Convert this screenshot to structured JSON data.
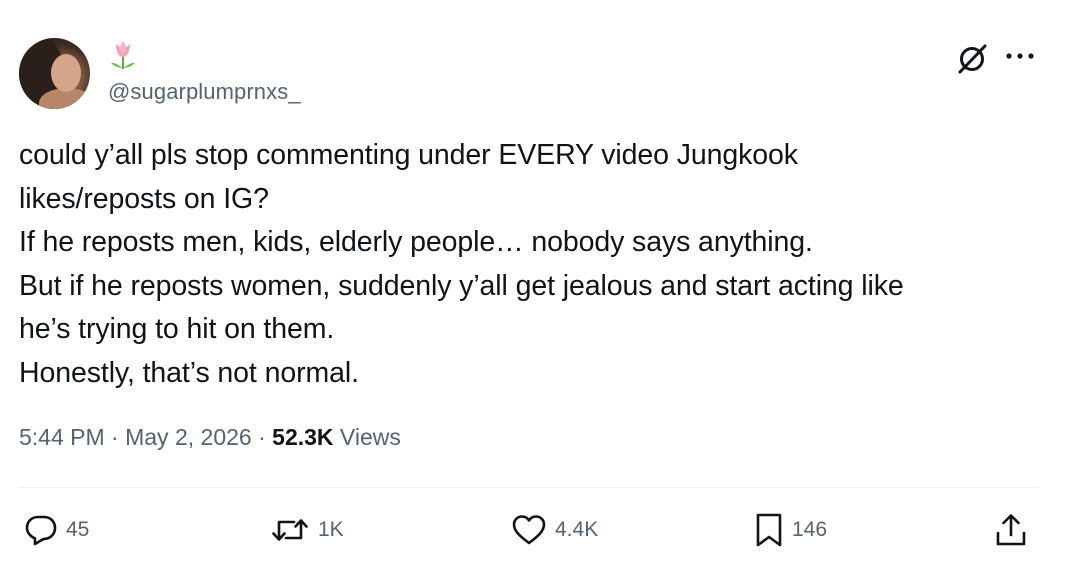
{
  "author": {
    "handle": "@sugarplumprnxs_",
    "name_emoji": "tulip"
  },
  "tweet": {
    "lines": [
      "could y’all pls stop commenting under EVERY video Jungkook",
      "likes/reposts on IG?",
      "If he reposts men, kids, elderly people… nobody says anything.",
      "But if he reposts women, suddenly y’all get jealous and start acting like",
      "he’s trying to hit on them.",
      "Honestly, that’s not normal."
    ],
    "time": "5:44 PM",
    "date": "May 2, 2026",
    "separator": "·",
    "views_count": "52.3K",
    "views_label": "Views"
  },
  "actions": {
    "replies": "45",
    "reposts": "1K",
    "likes": "4.4K",
    "bookmarks": "146"
  },
  "icons": [
    "avatar",
    "tulip-icon",
    "grok-icon",
    "more-icon",
    "reply-icon",
    "repost-icon",
    "like-icon",
    "bookmark-icon",
    "share-icon"
  ],
  "colors": {
    "text": "#0f1419",
    "secondary": "#536471",
    "divider": "#eff3f4"
  }
}
